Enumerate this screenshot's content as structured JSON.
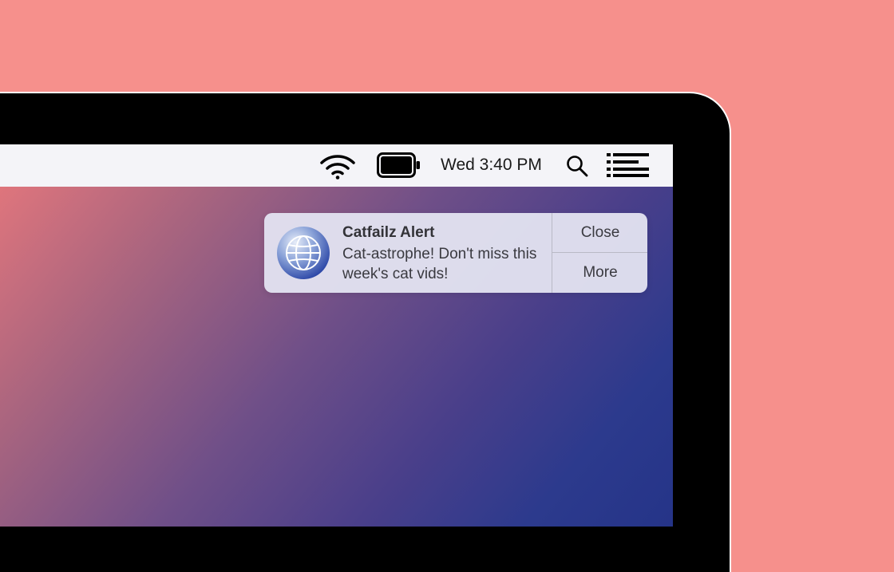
{
  "menubar": {
    "clock": "Wed 3:40 PM",
    "icons": [
      "wifi-icon",
      "battery-icon",
      "search-icon",
      "list-icon"
    ]
  },
  "notification": {
    "app_icon": "globe-icon",
    "title": "Catfailz Alert",
    "body": "Cat-astrophe! Don't miss this week's cat vids!",
    "actions": {
      "close_label": "Close",
      "more_label": "More"
    }
  },
  "colors": {
    "background": "#f6908c",
    "bezel": "#000000",
    "menubar": "#f4f4f8",
    "wallpaper_start": "#e8787c",
    "wallpaper_end": "#253488",
    "notification_bg": "#e2e2f0"
  }
}
